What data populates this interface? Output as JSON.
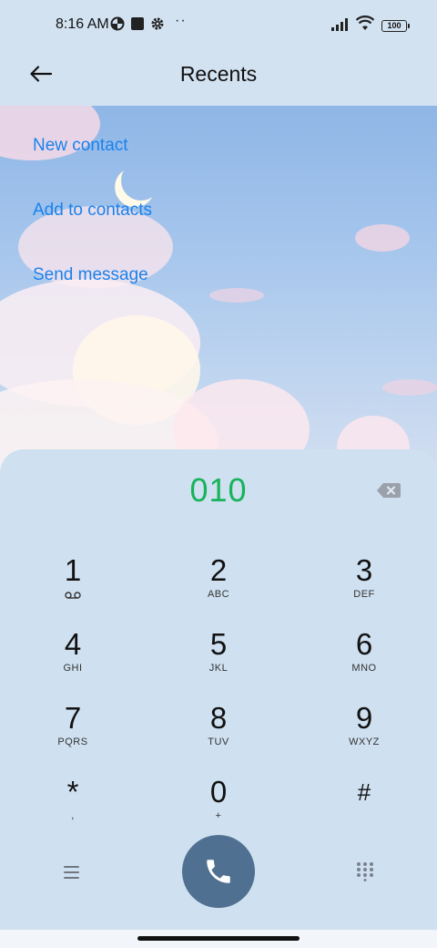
{
  "status": {
    "time": "8:16 AM",
    "more": "··",
    "battery": "100",
    "icons": [
      "data-saver-icon",
      "square-notification-icon",
      "gear-icon",
      "signal-icon",
      "wifi-icon",
      "battery-icon"
    ]
  },
  "header": {
    "title": "Recents",
    "back_icon": "arrow-left-icon"
  },
  "actions": [
    {
      "label": "New contact"
    },
    {
      "label": "Add to contacts"
    },
    {
      "label": "Send message"
    }
  ],
  "dialer": {
    "number": "010",
    "backspace_icon": "backspace-icon",
    "keys": [
      {
        "digit": "1",
        "letters": ""
      },
      {
        "digit": "2",
        "letters": "ABC"
      },
      {
        "digit": "3",
        "letters": "DEF"
      },
      {
        "digit": "4",
        "letters": "GHI"
      },
      {
        "digit": "5",
        "letters": "JKL"
      },
      {
        "digit": "6",
        "letters": "MNO"
      },
      {
        "digit": "7",
        "letters": "PQRS"
      },
      {
        "digit": "8",
        "letters": "TUV"
      },
      {
        "digit": "9",
        "letters": "WXYZ"
      },
      {
        "digit": "*",
        "letters": ","
      },
      {
        "digit": "0",
        "letters": "+"
      },
      {
        "digit": "#",
        "letters": ""
      }
    ],
    "voicemail_icon": "voicemail-icon",
    "menu_icon": "menu-icon",
    "call_icon": "phone-icon",
    "keypad_icon": "dialpad-icon"
  },
  "colors": {
    "accent_link": "#1a82ec",
    "number": "#16b35a",
    "call_button": "#4f7090",
    "background": "#cfe0f0"
  }
}
